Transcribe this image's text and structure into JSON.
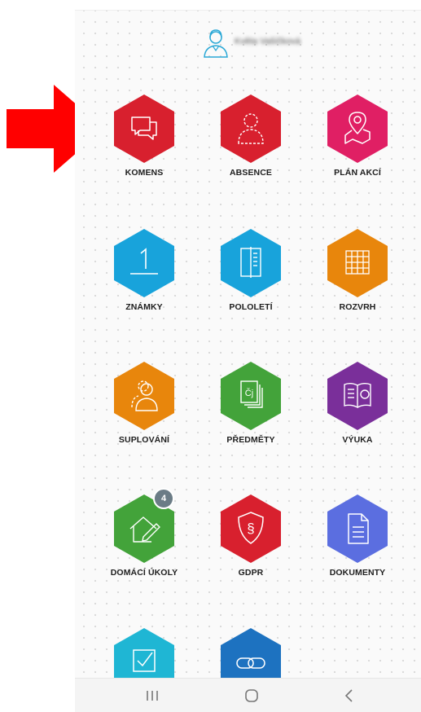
{
  "user": {
    "name": "Květa Vašíčková",
    "avatar_icon": "user-avatar-icon"
  },
  "tiles": [
    {
      "label": "KOMENS",
      "color": "#d8202e",
      "icon": "chat-bubbles-icon"
    },
    {
      "label": "ABSENCE",
      "color": "#d8202e",
      "icon": "absent-person-icon"
    },
    {
      "label": "PLÁN AKCÍ",
      "color": "#e01f64",
      "icon": "map-pin-icon"
    },
    {
      "label": "ZNÁMKY",
      "color": "#18a3db",
      "icon": "grade-one-icon"
    },
    {
      "label": "POLOLETÍ",
      "color": "#18a3db",
      "icon": "open-book-icon"
    },
    {
      "label": "ROZVRH",
      "color": "#e8860c",
      "icon": "timetable-grid-icon"
    },
    {
      "label": "SUPLOVÁNÍ",
      "color": "#e8860c",
      "icon": "substitute-person-icon"
    },
    {
      "label": "PŘEDMĚTY",
      "color": "#43a33a",
      "icon": "subject-cards-icon",
      "glyph": "Čj"
    },
    {
      "label": "VÝUKA",
      "color": "#7a2f9a",
      "icon": "lesson-book-icon"
    },
    {
      "label": "DOMÁCÍ ÚKOLY",
      "color": "#43a33a",
      "icon": "homework-pencil-icon",
      "badge": "4"
    },
    {
      "label": "GDPR",
      "color": "#d8202e",
      "icon": "gdpr-shield-icon",
      "glyph": "§"
    },
    {
      "label": "DOKUMENTY",
      "color": "#5b6ee0",
      "icon": "document-icon"
    },
    {
      "label": "",
      "color": "#1fb6d4",
      "icon": "checkbox-icon"
    },
    {
      "label": "",
      "color": "#1d72c0",
      "icon": "link-icon"
    }
  ],
  "navbar": {
    "recent": "recent-apps-icon",
    "home": "home-icon",
    "back": "back-icon"
  },
  "annotation": {
    "arrow_color": "#ff0000",
    "icon": "red-arrow-icon"
  }
}
